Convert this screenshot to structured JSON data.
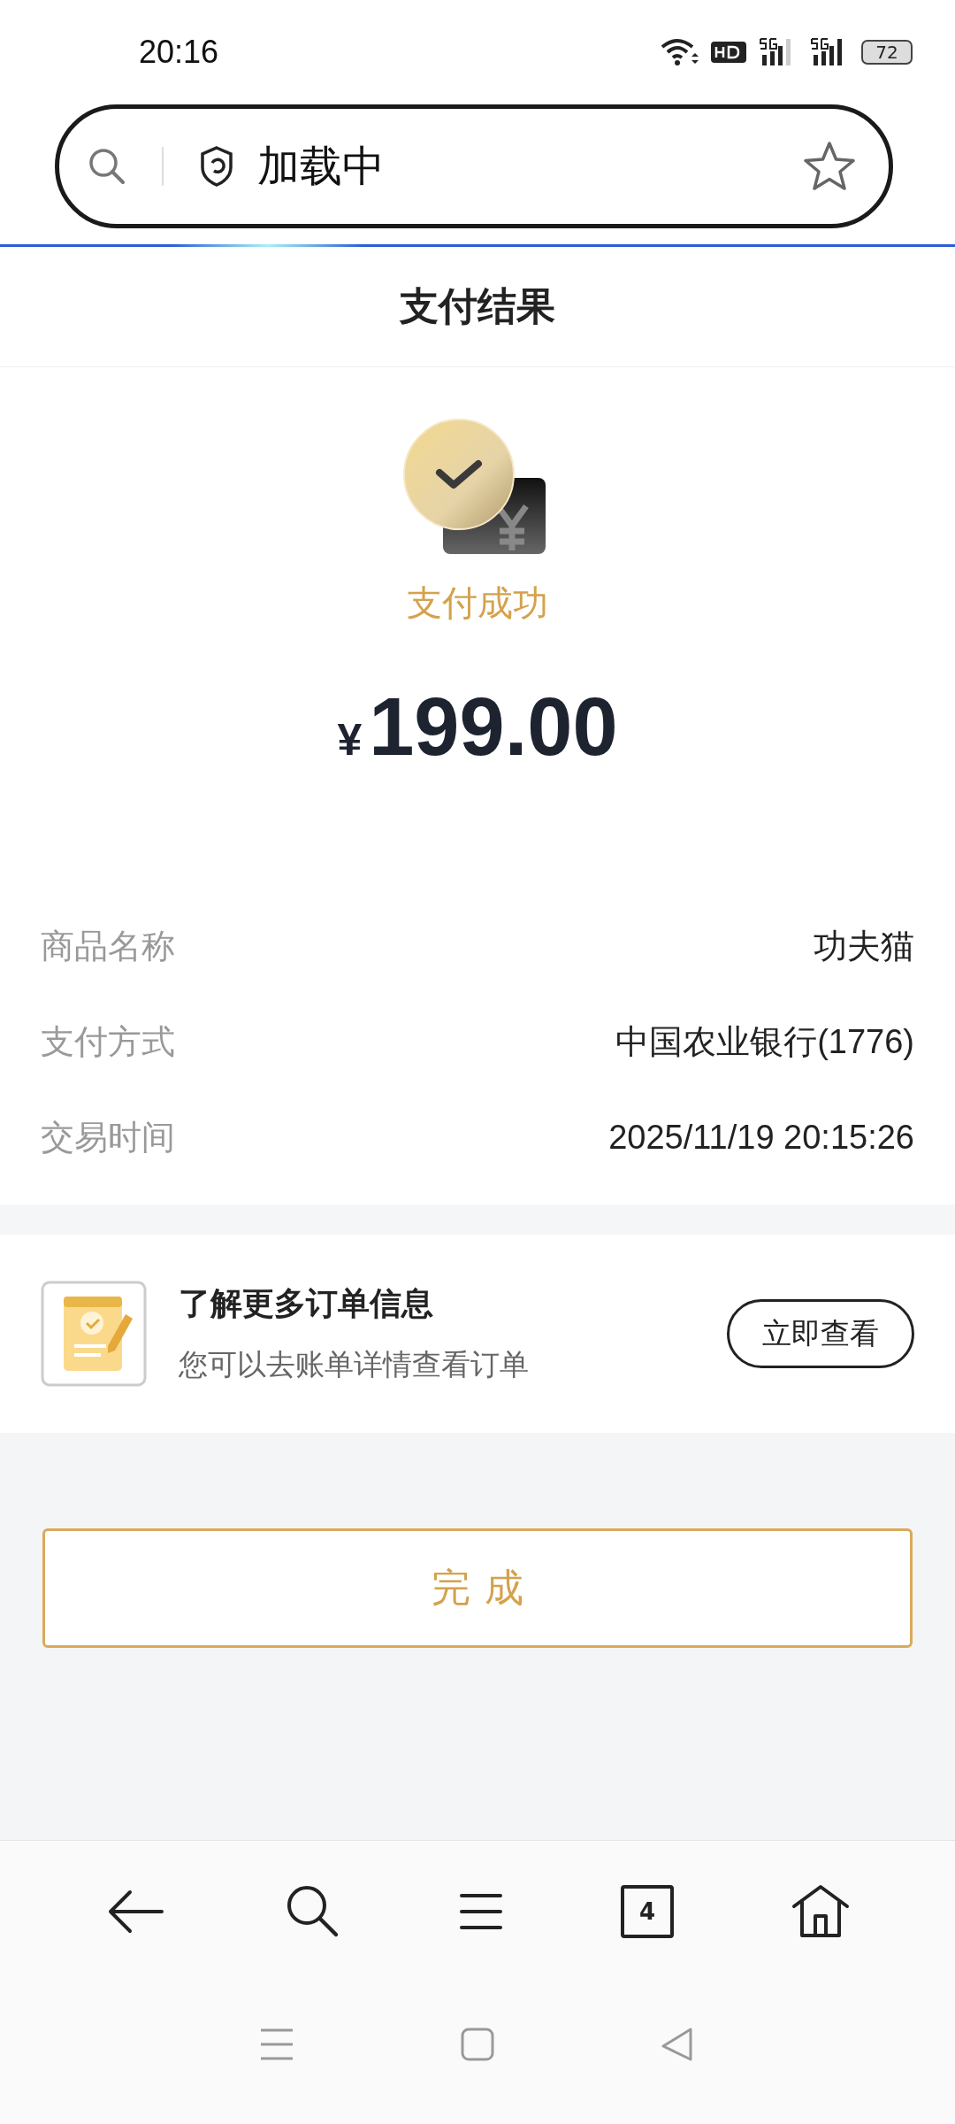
{
  "status_bar": {
    "time": "20:16",
    "battery": "72"
  },
  "address_bar": {
    "text": "加载中"
  },
  "header": {
    "title": "支付结果"
  },
  "result": {
    "status": "支付成功",
    "currency": "¥",
    "amount": "199.00"
  },
  "details": [
    {
      "label": "商品名称",
      "value": "功夫猫"
    },
    {
      "label": "支付方式",
      "value": "中国农业银行(1776)"
    },
    {
      "label": "交易时间",
      "value": "2025/11/19 20:15:26"
    }
  ],
  "order_info": {
    "title": "了解更多订单信息",
    "subtitle": "您可以去账单详情查看订单",
    "button": "立即查看"
  },
  "done_button": "完成",
  "toolbar": {
    "tab_count": "4"
  }
}
